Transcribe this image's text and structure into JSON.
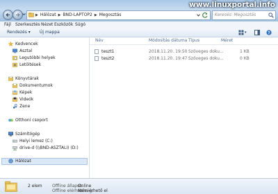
{
  "watermark": "www.linuxportal.info",
  "address": {
    "crumbs": [
      "Hálózat",
      "BND-LAPTOP2",
      "Megosztás"
    ]
  },
  "search": {
    "placeholder": "Keresés: Megosztás"
  },
  "menubar": {
    "items": [
      "Fájl",
      "Szerkesztés",
      "Nézet",
      "Eszközök",
      "Súgó"
    ]
  },
  "toolbar": {
    "organize": "Rendezés",
    "new_folder": "Új mappa"
  },
  "navpane": {
    "favorites": "Kedvencek",
    "desktop": "Asztal",
    "recent_places": "Legutóbbi helyek",
    "downloads": "Letöltések",
    "libraries": "Könyvtárak",
    "documents": "Dokumentumok",
    "pictures": "Képek",
    "videos": "Videók",
    "music": "Zene",
    "homegroup": "Otthoni csoport",
    "computer": "Számítógép",
    "local_disk": "Helyi lemez (C:)",
    "drive_d": "drive-d (\\\\BND-ASZTALI) (D:)",
    "network": "Hálózat"
  },
  "columns": {
    "name": "Név",
    "modified": "Módosítás dátuma",
    "type": "Típus",
    "size": "Méret"
  },
  "files": [
    {
      "name": "teszt1",
      "modified": "2018.11.20. 19:50",
      "type": "Szöveges doku...",
      "size": "1 KB"
    },
    {
      "name": "teszt2",
      "modified": "2018.11.20. 19:47",
      "type": "Szöveges doku...",
      "size": "0 KB"
    }
  ],
  "status": {
    "count": "2 elem",
    "offline_label": "Offline állapot:",
    "offline_value": "Online",
    "availability_label": "Offline elérhetőség:",
    "availability_value": "Nem érhető el"
  },
  "colors": {
    "accent": "#1e395b",
    "folder": "#e9c35a",
    "selection": "#dbe8f7"
  }
}
